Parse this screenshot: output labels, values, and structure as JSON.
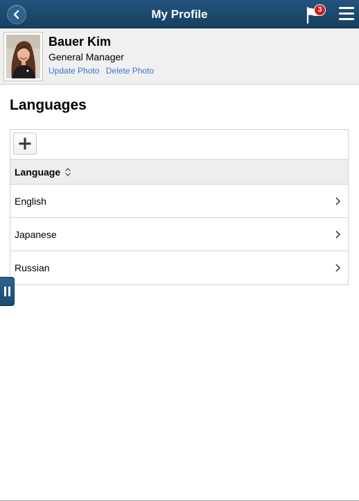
{
  "header": {
    "title": "My Profile",
    "back_icon": "chevron-left-icon",
    "notifications_icon": "flag-icon",
    "notifications_count": "3",
    "menu_icon": "hamburger-menu-icon"
  },
  "profile": {
    "name": "Bauer Kim",
    "job_title": "General Manager",
    "update_photo_label": "Update Photo",
    "delete_photo_label": "Delete Photo"
  },
  "section": {
    "title": "Languages",
    "add_icon": "plus-icon",
    "column_header": "Language",
    "sort_icon": "sort-updown-icon",
    "rows": [
      {
        "label": "English"
      },
      {
        "label": "Japanese"
      },
      {
        "label": "Russian"
      }
    ],
    "row_icon": "chevron-right-icon"
  },
  "side_handle_icon": "pause-icon",
  "colors": {
    "header_bg": "#1b4a70",
    "link": "#3c72c4",
    "badge": "#d41a1a",
    "banner_bg": "#f0f0f0",
    "grid_header_bg": "#eeeeee"
  }
}
